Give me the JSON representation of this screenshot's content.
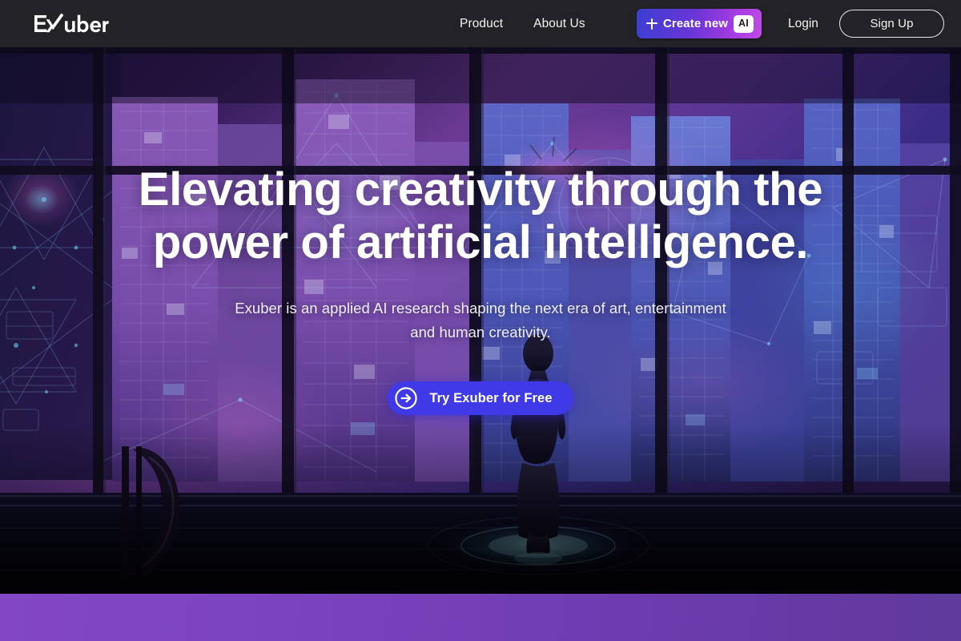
{
  "brand": {
    "name": "Exuber",
    "logo_icon": "exuber-wordmark"
  },
  "header": {
    "background": "#232327",
    "nav_items": [
      {
        "label": "Product"
      },
      {
        "label": "About Us"
      }
    ],
    "create_button": {
      "icon": "plus-icon",
      "label": "Create new",
      "badge": "AI",
      "gradient_from": "#3b3fd2",
      "gradient_to": "#c24ae8"
    },
    "login_label": "Login",
    "signup_label": "Sign Up"
  },
  "hero": {
    "headline_line1": "Elevating creativity through the",
    "headline_line2": "power of artificial intelligence.",
    "subhead_line1": "Exuber is an applied AI research shaping the next era of",
    "subhead_line2": "art, entertainment and human creativity.",
    "cta": {
      "label": "Try Exuber for Free",
      "icon": "arrow-right-circle-icon",
      "color": "#3f39e8"
    }
  },
  "footer_band": {
    "gradient_from": "#8347c4",
    "gradient_to": "#5f399b"
  }
}
